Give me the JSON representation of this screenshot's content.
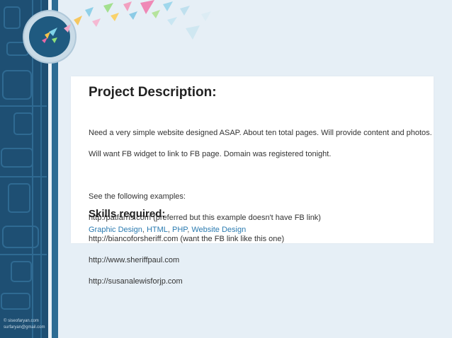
{
  "project": {
    "title": "Project Description:",
    "description_lines": [
      "Need a very simple website designed ASAP. About ten total pages. Will provide content and photos.",
      "Will want FB widget to link to FB page. Domain was registered tonight."
    ],
    "examples_intro": "See the following examples:",
    "example_lines": [
      "http:/patfarris.com (preferred but this example doesn't have FB link)",
      "http://biancoforsheriff.com (want the FB link like this one)",
      "http://www.sheriffpaul.com",
      "http://susanalewisforjp.com"
    ],
    "skills_title": "Skills required:",
    "skills": [
      "Graphic Design",
      "HTML",
      "PHP",
      "Website Design"
    ]
  },
  "sidebar": {
    "credit_lines": [
      "© siseofaryan.com",
      "surfaryan@gmail.com"
    ]
  },
  "colors": {
    "background": "#e6eff6",
    "sidebar": "#1e4f73",
    "link": "#2b7bb0"
  }
}
